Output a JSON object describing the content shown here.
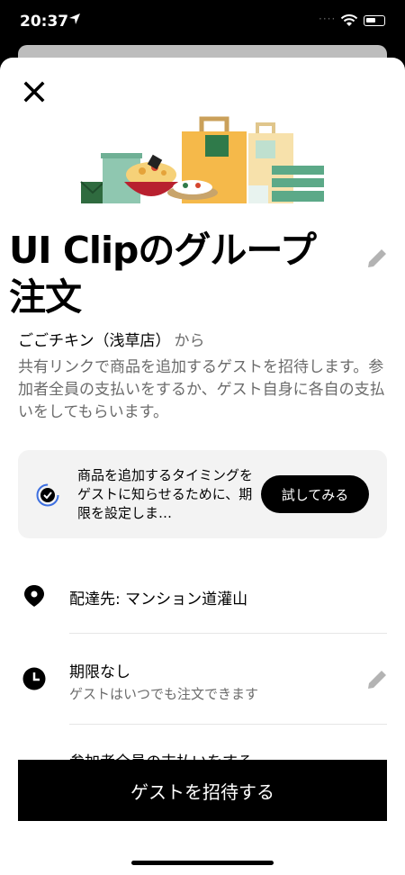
{
  "status": {
    "time": "20:37"
  },
  "sheet": {
    "title": "UI Clipのグループ注文",
    "store_name": "ごごチキン（浅草店）",
    "store_from": "から",
    "description": "共有リンクで商品を追加するゲストを招待します。参加者全員の支払いをするか、ゲスト自身に各自の支払いをしてもらいます。",
    "promo": {
      "text": "商品を追加するタイミングをゲストに知らせるために、期限を設定しま…",
      "button_label": "試してみる"
    },
    "rows": {
      "delivery": "配達先: マンション道灌山",
      "deadline_title": "期限なし",
      "deadline_sub": "ゲストはいつでも注文できます",
      "payment": "参加者全員の支払いをする"
    },
    "cta_label": "ゲストを招待する"
  },
  "icons": {
    "close": "close-icon",
    "edit": "pencil-icon",
    "location": "location-pin-icon",
    "clock": "clock-icon",
    "promo": "timer-check-icon"
  }
}
